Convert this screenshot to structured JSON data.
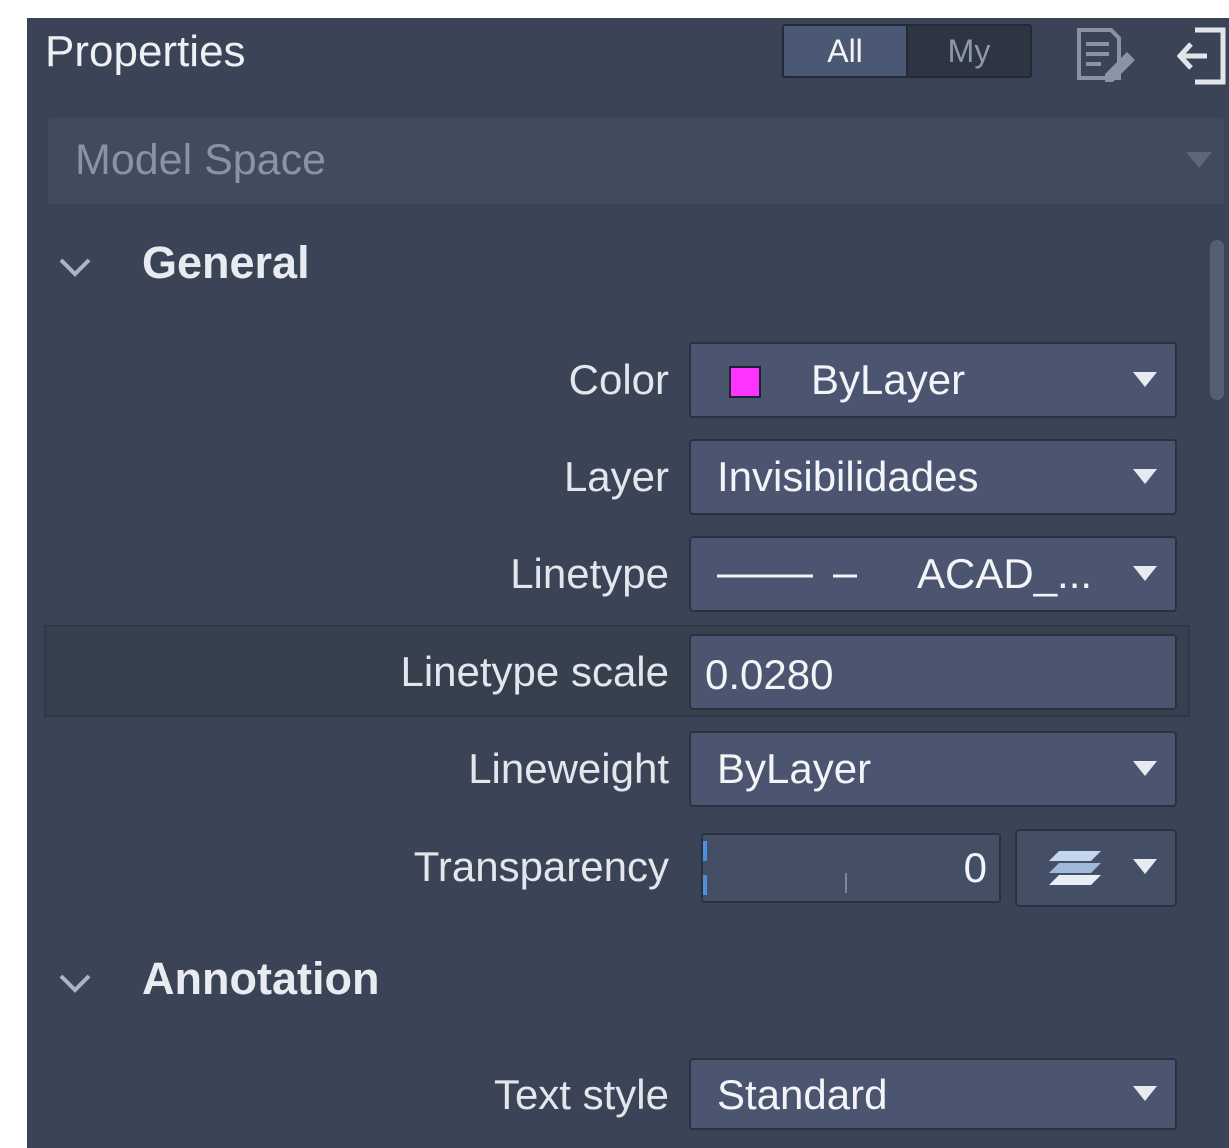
{
  "header": {
    "title": "Properties",
    "filter_all": "All",
    "filter_my": "My"
  },
  "space_selector": {
    "value": "Model Space"
  },
  "sections": {
    "general": {
      "title": "General",
      "color": {
        "label": "Color",
        "value": "ByLayer",
        "swatch": "#ff33ff"
      },
      "layer": {
        "label": "Layer",
        "value": "Invisibilidades"
      },
      "linetype": {
        "label": "Linetype",
        "value": "ACAD_..."
      },
      "linetype_scale": {
        "label": "Linetype scale",
        "value": "0.0280"
      },
      "lineweight": {
        "label": "Lineweight",
        "value": "ByLayer"
      },
      "transparency": {
        "label": "Transparency",
        "value": "0"
      }
    },
    "annotation": {
      "title": "Annotation",
      "text_style": {
        "label": "Text style",
        "value": "Standard"
      }
    }
  },
  "icons": {
    "properties": "properties-edit-icon",
    "exit": "exit-panel-icon",
    "layers": "layers-icon"
  },
  "colors": {
    "panel": "#3a4456",
    "field": "#4b5570",
    "accent": "#4b5873"
  }
}
